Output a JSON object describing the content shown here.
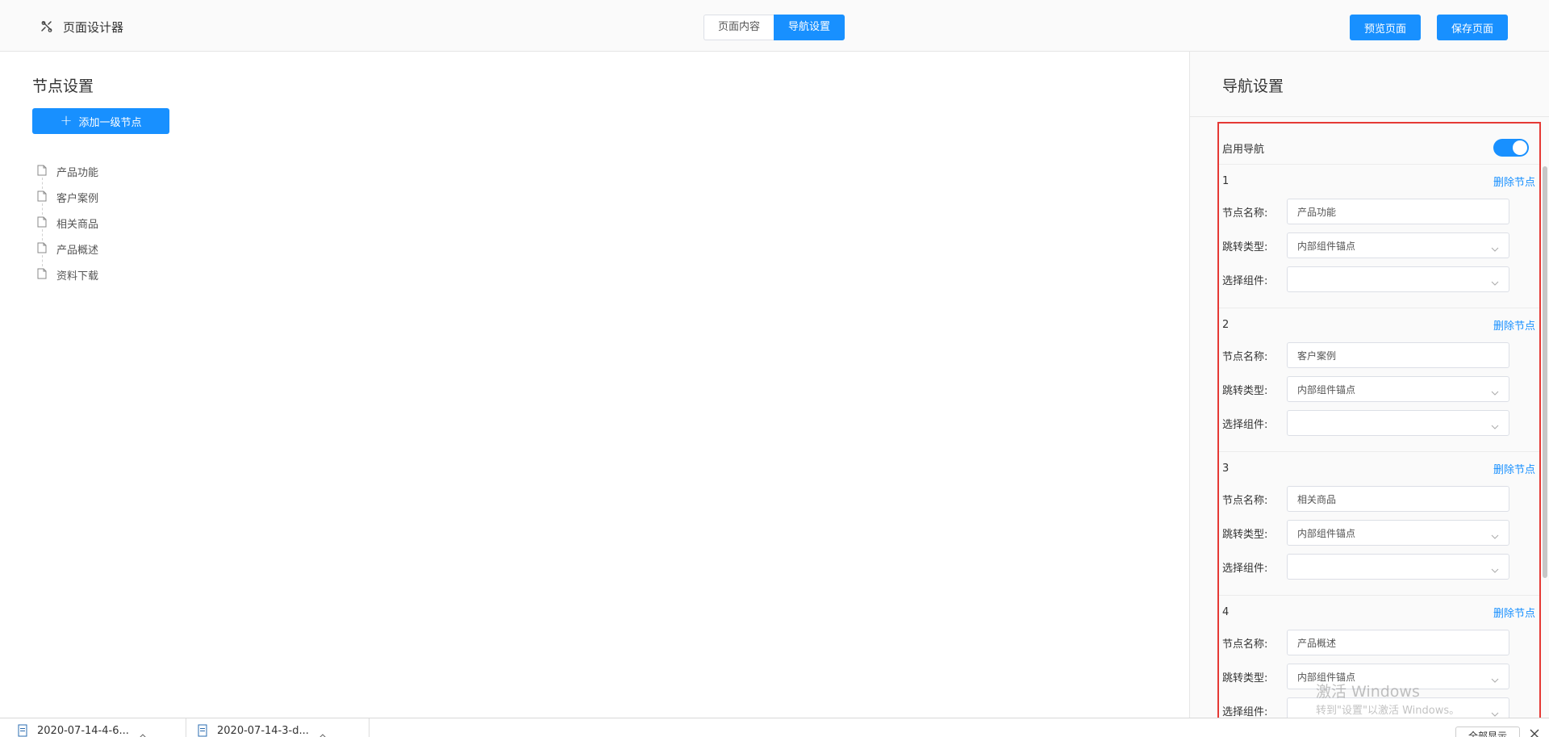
{
  "header": {
    "title": "页面设计器",
    "tabs": [
      {
        "label": "页面内容",
        "active": false
      },
      {
        "label": "导航设置",
        "active": true
      }
    ],
    "preview_label": "预览页面",
    "save_label": "保存页面"
  },
  "left": {
    "title": "节点设置",
    "add_label": "添加一级节点",
    "tree": [
      "产品功能",
      "客户案例",
      "相关商品",
      "产品概述",
      "资料下载"
    ]
  },
  "right": {
    "title": "导航设置",
    "enable_label": "启用导航",
    "enabled": true,
    "delete_label": "删除节点",
    "name_label": "节点名称:",
    "type_label": "跳转类型:",
    "component_label": "选择组件:",
    "nodes": [
      {
        "num": "1",
        "name": "产品功能",
        "type": "内部组件锚点",
        "component": ""
      },
      {
        "num": "2",
        "name": "客户案例",
        "type": "内部组件锚点",
        "component": ""
      },
      {
        "num": "3",
        "name": "相关商品",
        "type": "内部组件锚点",
        "component": ""
      },
      {
        "num": "4",
        "name": "产品概述",
        "type": "内部组件锚点",
        "component": ""
      }
    ]
  },
  "watermark": {
    "line1": "激活 Windows",
    "line2": "转到\"设置\"以激活 Windows。"
  },
  "downloads": {
    "items": [
      "2020-07-14-4-6...",
      "2020-07-14-3-d..."
    ],
    "show_all": "全部显示"
  },
  "colors": {
    "accent": "#1890ff",
    "highlight_border": "#e53935"
  }
}
